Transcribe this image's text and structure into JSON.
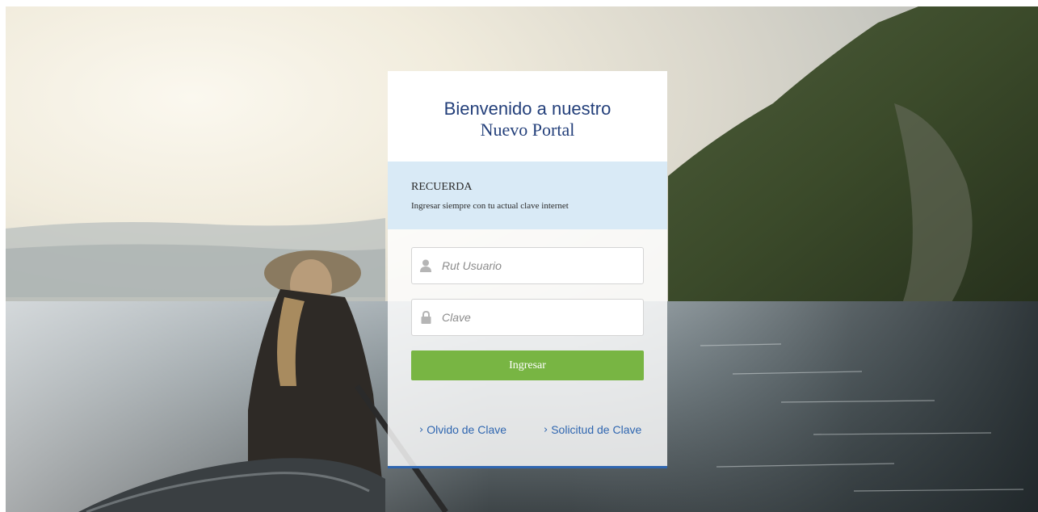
{
  "welcome": {
    "title_line1": "Bienvenido a nuestro",
    "title_line2": "Nuevo Portal"
  },
  "notice": {
    "title": "RECUERDA",
    "text": "Ingresar siempre con tu actual clave internet"
  },
  "form": {
    "user_placeholder": "Rut Usuario",
    "user_icon": "user-icon",
    "password_placeholder": "Clave",
    "password_icon": "lock-icon",
    "submit_label": "Ingresar"
  },
  "links": {
    "forgot_label": "Olvido de Clave",
    "request_label": "Solicitud de Clave",
    "chevron": "›"
  },
  "colors": {
    "title": "#233f7a",
    "notice_bg": "#d7e9f6",
    "button": "#78b543",
    "link": "#2f66b0"
  }
}
